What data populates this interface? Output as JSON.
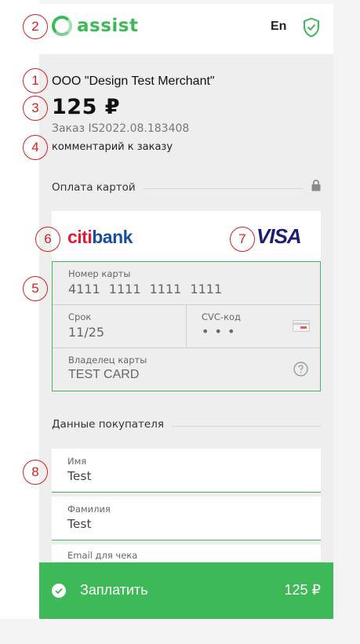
{
  "header": {
    "logo_text": "assist",
    "language": "En",
    "shield_icon": "shield-check-icon"
  },
  "markers": [
    "1",
    "2",
    "3",
    "4",
    "5",
    "6",
    "7",
    "8"
  ],
  "order": {
    "merchant": "ООО \"Design Test Merchant\"",
    "amount": "125 ₽",
    "order_number": "Заказ IS2022.08.183408",
    "comment": "комментарий к заказу"
  },
  "payment_section": {
    "title": "Оплата картой",
    "lock_icon": "lock-icon"
  },
  "card": {
    "bank_prefix": "citi",
    "bank_suffix": "bank",
    "brand": "VISA",
    "number_label": "Номер карты",
    "number_value": "4111 1111 1111 1111",
    "expiry_label": "Срок",
    "expiry_value": "11/25",
    "cvc_label": "CVC-код",
    "cvc_value": "• • •",
    "holder_label": "Владелец карты",
    "holder_value": "TEST CARD"
  },
  "buyer_section": {
    "title": "Данные покупателя",
    "first_name_label": "Имя",
    "first_name_value": "Test",
    "last_name_label": "Фамилия",
    "last_name_value": "Test",
    "email_label": "Email для чека"
  },
  "pay_button": {
    "label": "Заплатить",
    "amount": "125 ₽"
  },
  "colors": {
    "accent": "#3dba57",
    "marker": "#d81f1f",
    "bank_blue": "#1a4d9c",
    "visa_blue": "#1a1f71"
  }
}
